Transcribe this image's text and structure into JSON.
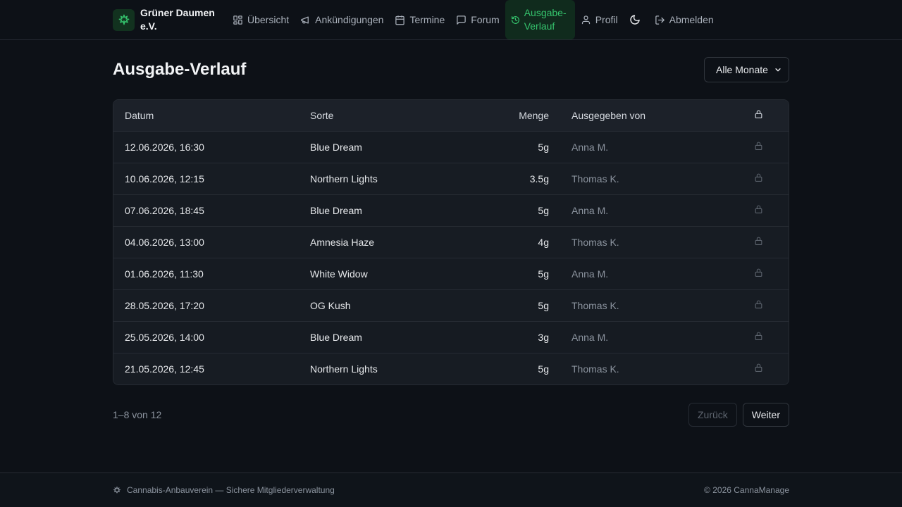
{
  "brand": {
    "name": "Grüner Daumen e.V."
  },
  "nav": {
    "items": [
      {
        "label": "Übersicht",
        "icon": "dashboard-icon"
      },
      {
        "label": "Ankündigungen",
        "icon": "megaphone-icon"
      },
      {
        "label": "Termine",
        "icon": "calendar-icon"
      },
      {
        "label": "Forum",
        "icon": "chat-icon"
      },
      {
        "label": "Ausgabe-Verlauf",
        "icon": "history-icon",
        "active": true
      },
      {
        "label": "Profil",
        "icon": "user-icon"
      }
    ],
    "theme_icon": "moon-icon",
    "logout": {
      "label": "Abmelden",
      "icon": "logout-icon"
    }
  },
  "page": {
    "title": "Ausgabe-Verlauf",
    "filter": {
      "selected": "Alle Monate"
    }
  },
  "table": {
    "headers": {
      "date": "Datum",
      "sort": "Sorte",
      "amount": "Menge",
      "by": "Ausgegeben von",
      "lock_icon": "lock-icon"
    },
    "rows": [
      {
        "date": "12.06.2026, 16:30",
        "sort": "Blue Dream",
        "amount": "5g",
        "by": "Anna M."
      },
      {
        "date": "10.06.2026, 12:15",
        "sort": "Northern Lights",
        "amount": "3.5g",
        "by": "Thomas K."
      },
      {
        "date": "07.06.2026, 18:45",
        "sort": "Blue Dream",
        "amount": "5g",
        "by": "Anna M."
      },
      {
        "date": "04.06.2026, 13:00",
        "sort": "Amnesia Haze",
        "amount": "4g",
        "by": "Thomas K."
      },
      {
        "date": "01.06.2026, 11:30",
        "sort": "White Widow",
        "amount": "5g",
        "by": "Anna M."
      },
      {
        "date": "28.05.2026, 17:20",
        "sort": "OG Kush",
        "amount": "5g",
        "by": "Thomas K."
      },
      {
        "date": "25.05.2026, 14:00",
        "sort": "Blue Dream",
        "amount": "3g",
        "by": "Anna M."
      },
      {
        "date": "21.05.2026, 12:45",
        "sort": "Northern Lights",
        "amount": "5g",
        "by": "Thomas K."
      }
    ]
  },
  "pagination": {
    "info": "1–8 von 12",
    "prev_label": "Zurück",
    "next_label": "Weiter"
  },
  "footer": {
    "left": "Cannabis-Anbauverein — Sichere Mitgliederverwaltung",
    "right": "© 2026 CannaManage"
  },
  "colors": {
    "accent": "#35c46d",
    "background": "#0d1117",
    "card": "#161b22"
  }
}
